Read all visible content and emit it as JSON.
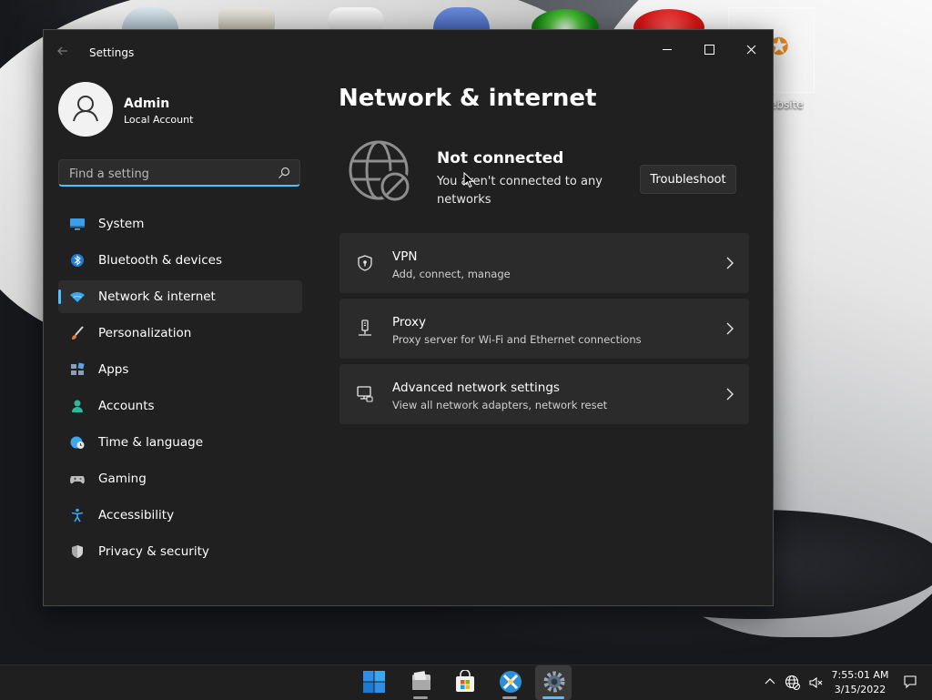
{
  "window": {
    "title": "Settings"
  },
  "user": {
    "name": "Admin",
    "account_type": "Local Account"
  },
  "search": {
    "placeholder": "Find a setting"
  },
  "nav": {
    "items": [
      {
        "label": "System",
        "icon": "monitor-icon"
      },
      {
        "label": "Bluetooth & devices",
        "icon": "bluetooth-icon"
      },
      {
        "label": "Network & internet",
        "icon": "wifi-icon",
        "active": true
      },
      {
        "label": "Personalization",
        "icon": "paintbrush-icon"
      },
      {
        "label": "Apps",
        "icon": "apps-icon"
      },
      {
        "label": "Accounts",
        "icon": "person-icon"
      },
      {
        "label": "Time & language",
        "icon": "globe-clock-icon"
      },
      {
        "label": "Gaming",
        "icon": "gamepad-icon"
      },
      {
        "label": "Accessibility",
        "icon": "accessibility-icon"
      },
      {
        "label": "Privacy & security",
        "icon": "shield-icon"
      }
    ]
  },
  "main": {
    "title": "Network & internet",
    "status": {
      "title": "Not connected",
      "description": "You aren't connected to any networks",
      "button_label": "Troubleshoot"
    },
    "cards": [
      {
        "title": "VPN",
        "subtitle": "Add, connect, manage",
        "icon": "vpn-shield-icon"
      },
      {
        "title": "Proxy",
        "subtitle": "Proxy server for Wi-Fi and Ethernet connections",
        "icon": "proxy-icon"
      },
      {
        "title": "Advanced network settings",
        "subtitle": "View all network adapters, network reset",
        "icon": "network-monitor-icon"
      }
    ]
  },
  "desktop": {
    "selected_icon_label": "ebsite"
  },
  "taskbar": {
    "time": "7:55:01 AM",
    "date": "3/15/2022"
  },
  "colors": {
    "accent": "#4cc2ff",
    "window_bg": "#202020",
    "card_bg": "#2b2b2b",
    "taskbar_bg": "#1f1f1f"
  }
}
